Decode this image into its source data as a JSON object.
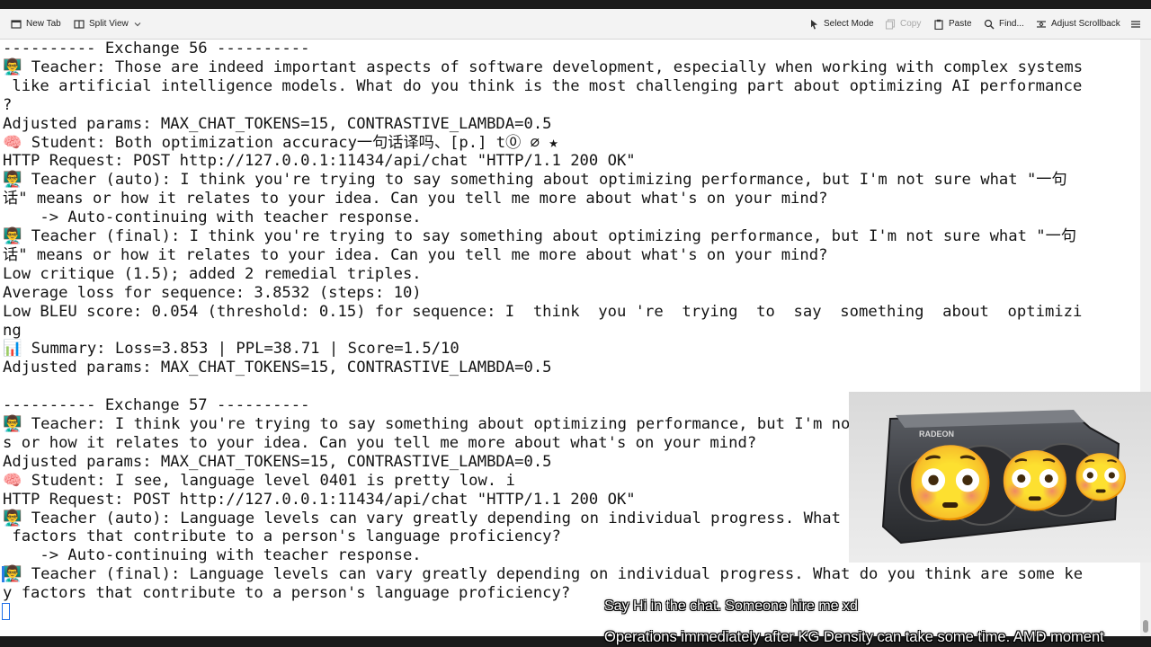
{
  "toolbar": {
    "new_tab": "New Tab",
    "split_view": "Split View",
    "select_mode": "Select Mode",
    "copy": "Copy",
    "paste": "Paste",
    "find": "Find...",
    "adjust_scrollback": "Adjust Scrollback"
  },
  "terminal": {
    "lines": [
      "---------- Exchange 56 ----------",
      "👨‍🏫 Teacher: Those are indeed important aspects of software development, especially when working with complex systems",
      " like artificial intelligence models. What do you think is the most challenging part about optimizing AI performance",
      "?",
      "Adjusted params: MAX_CHAT_TOKENS=15, CONTRASTIVE_LAMBDA=0.5",
      "🧠 Student: Both optimization accuracy一句话译吗、[p.] t⓪ ⌀ ★",
      "HTTP Request: POST http://127.0.0.1:11434/api/chat \"HTTP/1.1 200 OK\"",
      "👨‍🏫 Teacher (auto): I think you're trying to say something about optimizing performance, but I'm not sure what \"一句",
      "话\" means or how it relates to your idea. Can you tell me more about what's on your mind?",
      "    -> Auto-continuing with teacher response.",
      "👨‍🏫 Teacher (final): I think you're trying to say something about optimizing performance, but I'm not sure what \"一句",
      "话\" means or how it relates to your idea. Can you tell me more about what's on your mind?",
      "Low critique (1.5); added 2 remedial triples.",
      "Average loss for sequence: 3.8532 (steps: 10)",
      "Low BLEU score: 0.054 (threshold: 0.15) for sequence: I  think  you 're  trying  to  say  something  about  optimizi",
      "ng",
      "📊 Summary: Loss=3.853 | PPL=38.71 | Score=1.5/10",
      "Adjusted params: MAX_CHAT_TOKENS=15, CONTRASTIVE_LAMBDA=0.5",
      "",
      "---------- Exchange 57 ----------",
      "👨‍🏫 Teacher: I think you're trying to say something about optimizing performance, but I'm not sure what \"一句话\" mean",
      "s or how it relates to your idea. Can you tell me more about what's on your mind?",
      "Adjusted params: MAX_CHAT_TOKENS=15, CONTRASTIVE_LAMBDA=0.5",
      "🧠 Student: I see, language level 0401 is pretty low. i",
      "HTTP Request: POST http://127.0.0.1:11434/api/chat \"HTTP/1.1 200 OK\"",
      "👨‍🏫 Teacher (auto): Language levels can vary greatly depending on individual progress. What do you think are some key",
      " factors that contribute to a person's language proficiency?",
      "    -> Auto-continuing with teacher response.",
      "👨‍🏫 Teacher (final): Language levels can vary greatly depending on individual progress. What do you think are some ke",
      "y factors that contribute to a person's language proficiency?"
    ]
  },
  "webcam": {
    "gpu_brand": "RADEON",
    "emoji": [
      "😳",
      "😳",
      "😳"
    ]
  },
  "overlays": {
    "chat_message": "Say Hi in the chat. Someone hire me xd",
    "ticker": "Operations immediately after KG Density can take some time. AMD moment"
  },
  "colors": {
    "background": "#ffffff",
    "text": "#141414",
    "cursor": "#1e6ee8"
  }
}
